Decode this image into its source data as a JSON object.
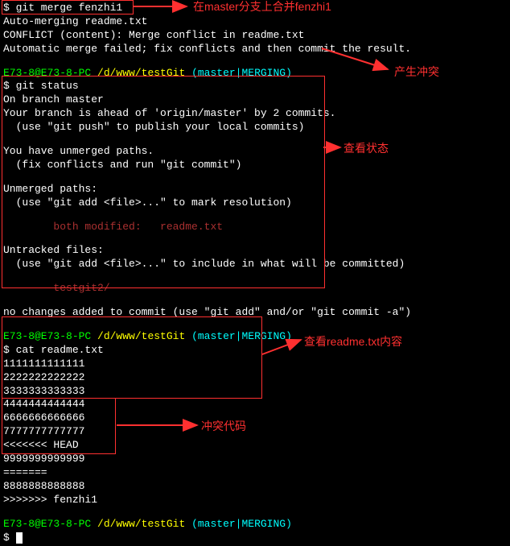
{
  "merge": {
    "cmd": "$ git merge fenzhi1",
    "auto": "Auto-merging readme.txt",
    "conflict": "CONFLICT (content): Merge conflict in readme.txt",
    "failed": "Automatic merge failed; fix conflicts and then commit the result."
  },
  "prompt1": {
    "user": "E73-8@E73-8-PC ",
    "path": "/d/www/testGit ",
    "branch": "(master|MERGING)"
  },
  "status": {
    "cmd": "$ git status",
    "on_branch": "On branch master",
    "ahead": "Your branch is ahead of 'origin/master' by 2 commits.",
    "push": "  (use \"git push\" to publish your local commits)",
    "unmerged_title": "You have unmerged paths.",
    "fix": "  (fix conflicts and run \"git commit\")",
    "unmerged_paths": "Unmerged paths:",
    "mark": "  (use \"git add <file>...\" to mark resolution)",
    "both_mod": "        both modified:   readme.txt",
    "untracked": "Untracked files:",
    "include": "  (use \"git add <file>...\" to include in what will be committed)",
    "untracked_file": "        testgit2/",
    "nochanges": "no changes added to commit (use \"git add\" and/or \"git commit -a\")"
  },
  "cat": {
    "cmd": "$ cat readme.txt",
    "l1": "1111111111111",
    "l2": "2222222222222",
    "l3": "3333333333333",
    "l4": "4444444444444",
    "l5": "6666666666666",
    "l6": "7777777777777",
    "head": "<<<<<<< HEAD",
    "l7": "9999999999999",
    "sep": "=======",
    "l8": "8888888888888",
    "tail": ">>>>>>> fenzhi1"
  },
  "last_prompt": "$ ",
  "annotations": {
    "a1": "在master分支上合并fenzhi1",
    "a2": "产生冲突",
    "a3": "查看状态",
    "a4": "查看readme.txt内容",
    "a5": "冲突代码"
  }
}
